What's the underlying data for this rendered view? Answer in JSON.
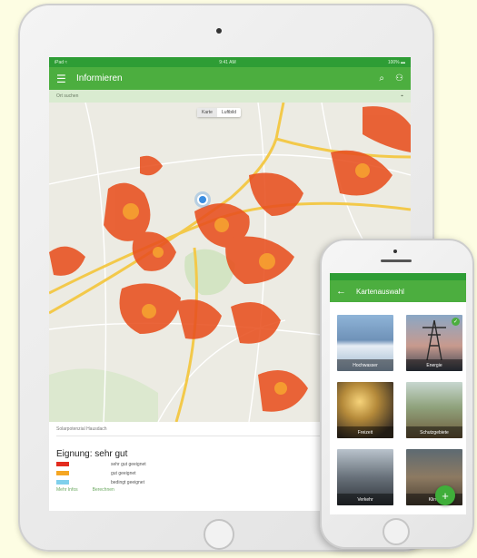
{
  "tablet": {
    "status": {
      "left": "iPad ≈",
      "center": "9:41 AM",
      "right": "100% ▬"
    },
    "app_bar": {
      "menu_icon": "menu-icon",
      "title": "Informieren",
      "search_icon": "search-icon",
      "account_icon": "account-icon"
    },
    "search": {
      "placeholder": "Ort suchen",
      "icon": "location-icon"
    },
    "map": {
      "toggle": [
        "Karte",
        "Luftbild"
      ],
      "active_toggle": "Karte"
    },
    "legend": {
      "header": "Solarpotenzial Hausdach",
      "title": "Eignung: sehr gut",
      "items": [
        {
          "label": "sehr gut geeignet",
          "color": "#e32b1e"
        },
        {
          "label": "gut geeignet",
          "color": "#f5a623"
        },
        {
          "label": "bedingt geeignet",
          "color": "#7fd0ec"
        }
      ],
      "footer": [
        "Mehr Infos",
        "Berechnen"
      ]
    }
  },
  "phone": {
    "app_bar": {
      "back_icon": "back-arrow-icon",
      "title": "Kartenauswahl"
    },
    "tiles": [
      {
        "label": "Hochwasser",
        "selected": false
      },
      {
        "label": "Energie",
        "selected": true
      },
      {
        "label": "Freizeit",
        "selected": false
      },
      {
        "label": "Schutzgebiete",
        "selected": false
      },
      {
        "label": "Verkehr",
        "selected": false
      },
      {
        "label": "Klima",
        "selected": false
      }
    ],
    "fab_label": "+"
  },
  "colors": {
    "primary": "#4cae3f",
    "primary_dark": "#2e9d35",
    "roof_high": "#e32b1e",
    "roof_mid": "#f5a623",
    "road": "#f3c94a"
  }
}
